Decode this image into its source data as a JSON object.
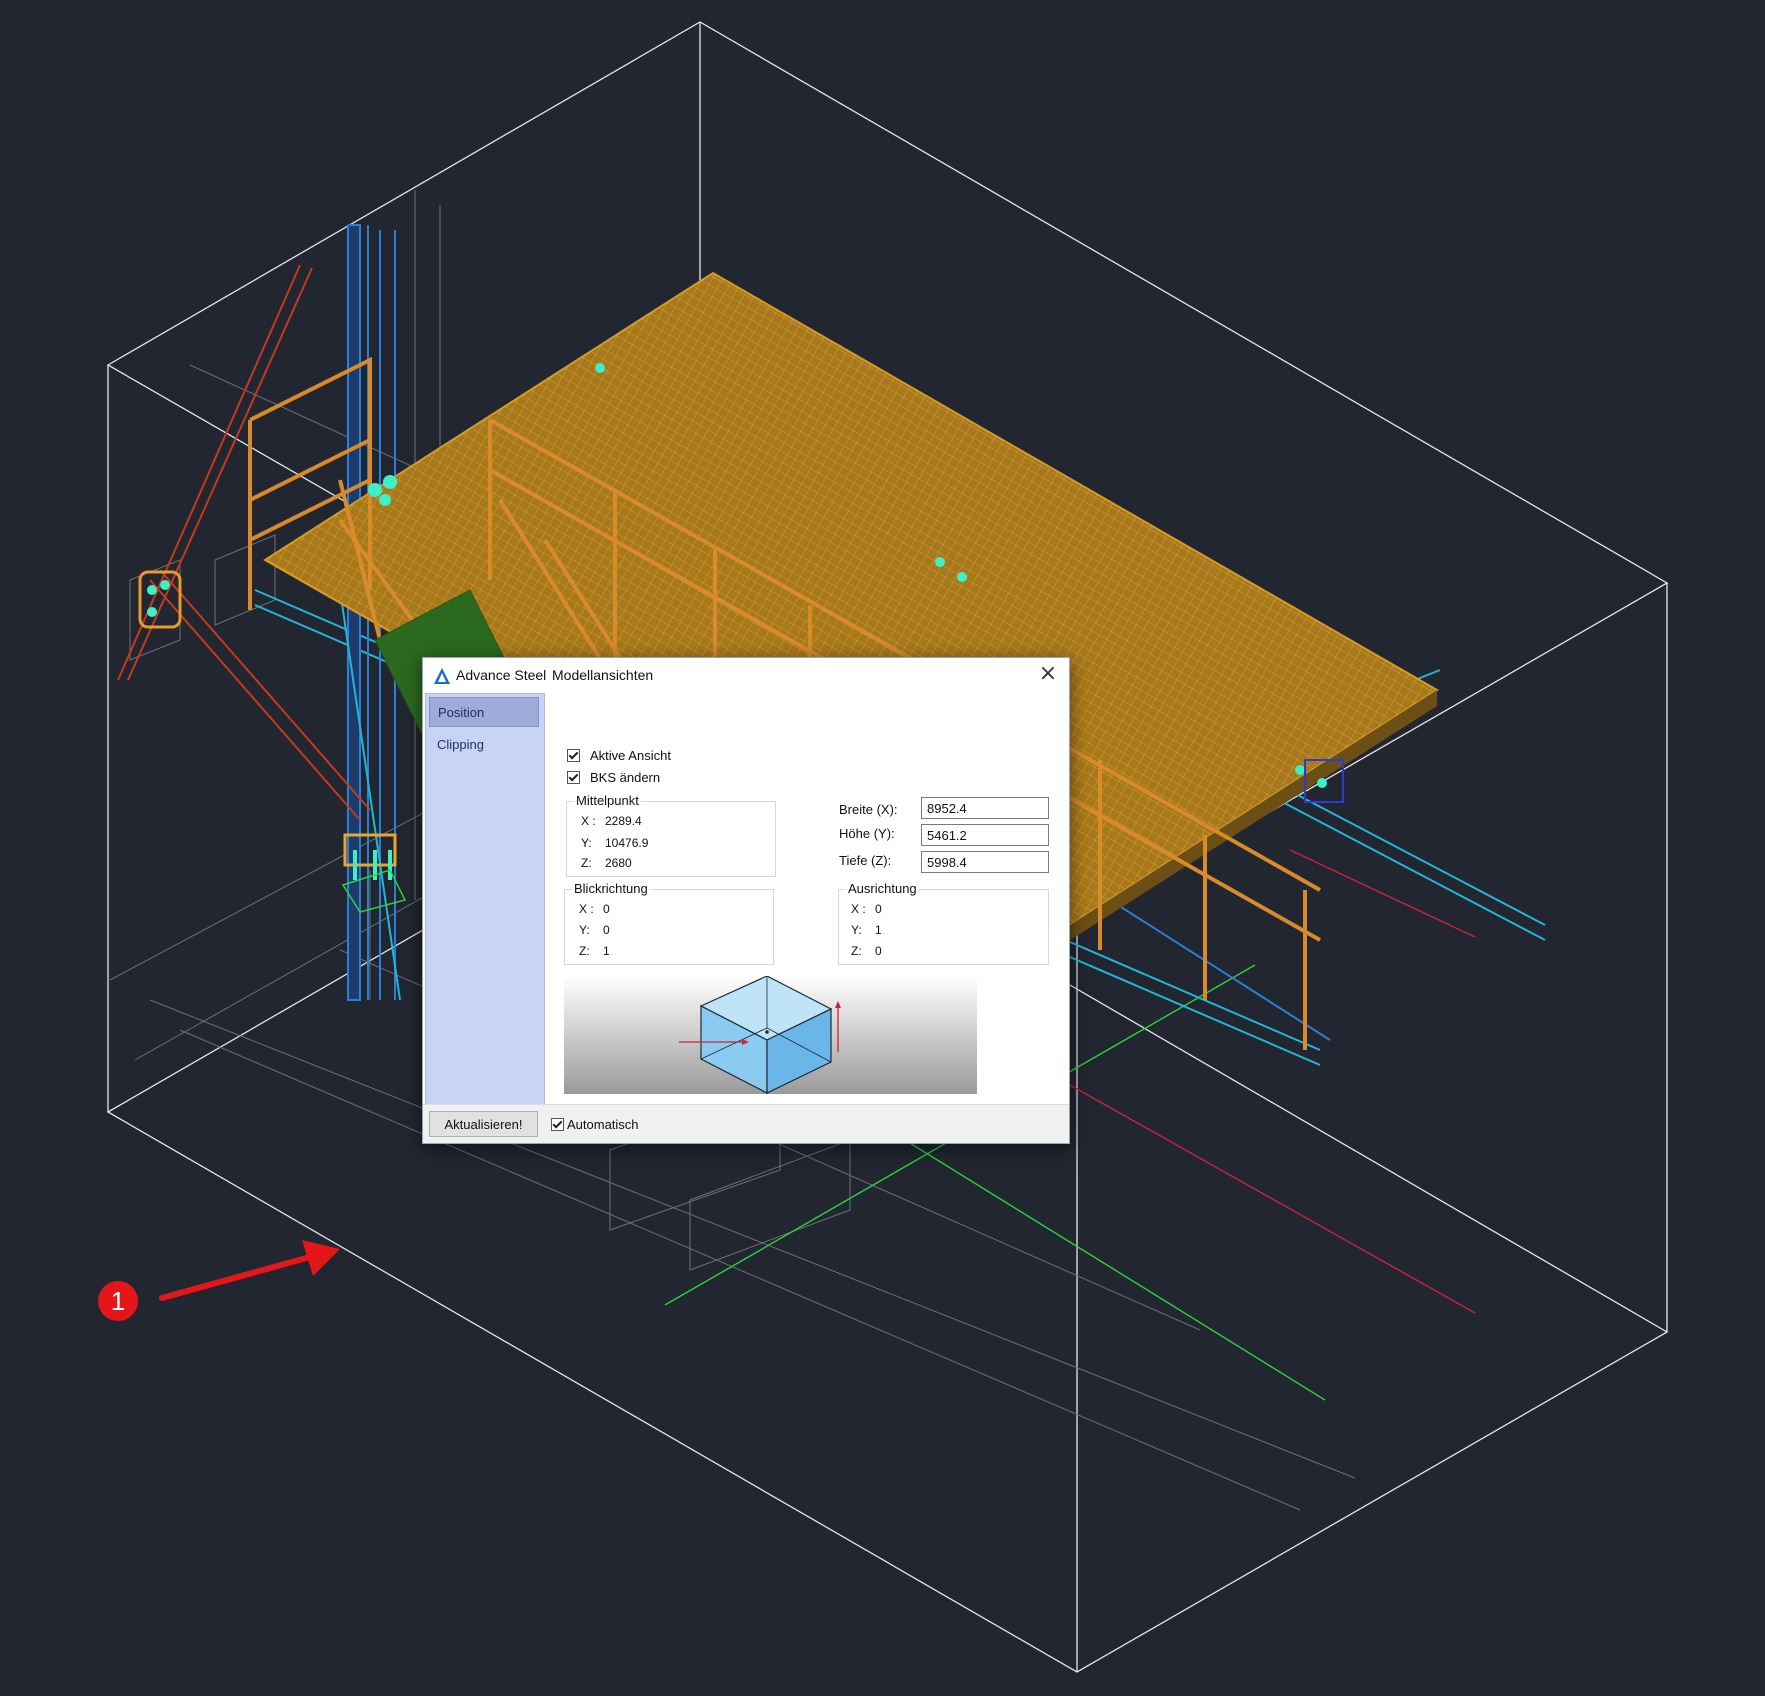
{
  "window": {
    "app_name": "Advance Steel",
    "title": "Modellansichten",
    "close_glyph": "×"
  },
  "sidebar": {
    "items": [
      {
        "label": "Position",
        "selected": true
      },
      {
        "label": "Clipping",
        "selected": false
      }
    ]
  },
  "options": {
    "aktive_ansicht": {
      "label": "Aktive Ansicht",
      "checked": true
    },
    "bks_aendern": {
      "label": "BKS ändern",
      "checked": true
    }
  },
  "mittelpunkt": {
    "title": "Mittelpunkt",
    "x_label": "X :",
    "x": "2289.4",
    "y_label": "Y:",
    "y": "10476.9",
    "z_label": "Z:",
    "z": "2680"
  },
  "dimensions": {
    "breite_label": "Breite (X):",
    "breite": "8952.4",
    "hoehe_label": "Höhe (Y):",
    "hoehe": "5461.2",
    "tiefe_label": "Tiefe (Z):",
    "tiefe": "5998.4"
  },
  "blickrichtung": {
    "title": "Blickrichtung",
    "x_label": "X :",
    "x": "0",
    "y_label": "Y:",
    "y": "0",
    "z_label": "Z:",
    "z": "1"
  },
  "ausrichtung": {
    "title": "Ausrichtung",
    "x_label": "X :",
    "x": "0",
    "y_label": "Y:",
    "y": "1",
    "z_label": "Z:",
    "z": "0"
  },
  "footer": {
    "update_label": "Aktualisieren!",
    "automatisch": {
      "label": "Automatisch",
      "checked": true
    }
  },
  "annotation": {
    "number": "1"
  },
  "colors": {
    "background": "#212630",
    "grating": "#c8921e",
    "handrail": "#d98a2b",
    "steel_blue": "#2a7fd6",
    "cyan": "#22b6d8",
    "bolts": "#3df0c8",
    "red_axis": "#d0203e",
    "green_axis": "#2fd23a",
    "annotation_red": "#e5161a",
    "sidebar": "#c7d4f5"
  }
}
